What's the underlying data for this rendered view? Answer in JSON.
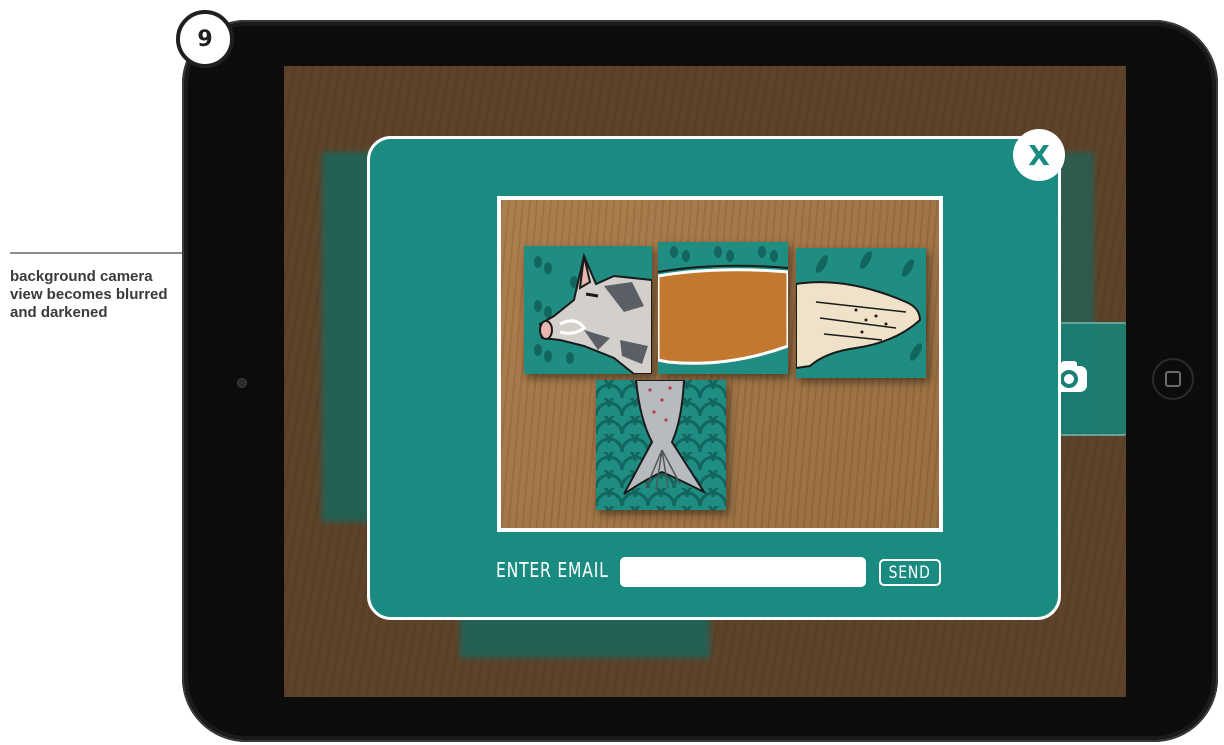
{
  "step": {
    "number": "9"
  },
  "annotation": {
    "text": "background camera view becomes blurred and darkened"
  },
  "modal": {
    "close_label": "X",
    "email_label": "ENTER EMAIL",
    "email_value": "",
    "email_placeholder": "",
    "send_label": "SEND"
  },
  "colors": {
    "teal": "#1a8b80",
    "wood": "#9c6e40",
    "screen_wood": "#6b4d2f"
  },
  "tiles": [
    "pig-head-tile",
    "brown-body-tile",
    "wing-tile",
    "fish-tail-tile"
  ]
}
